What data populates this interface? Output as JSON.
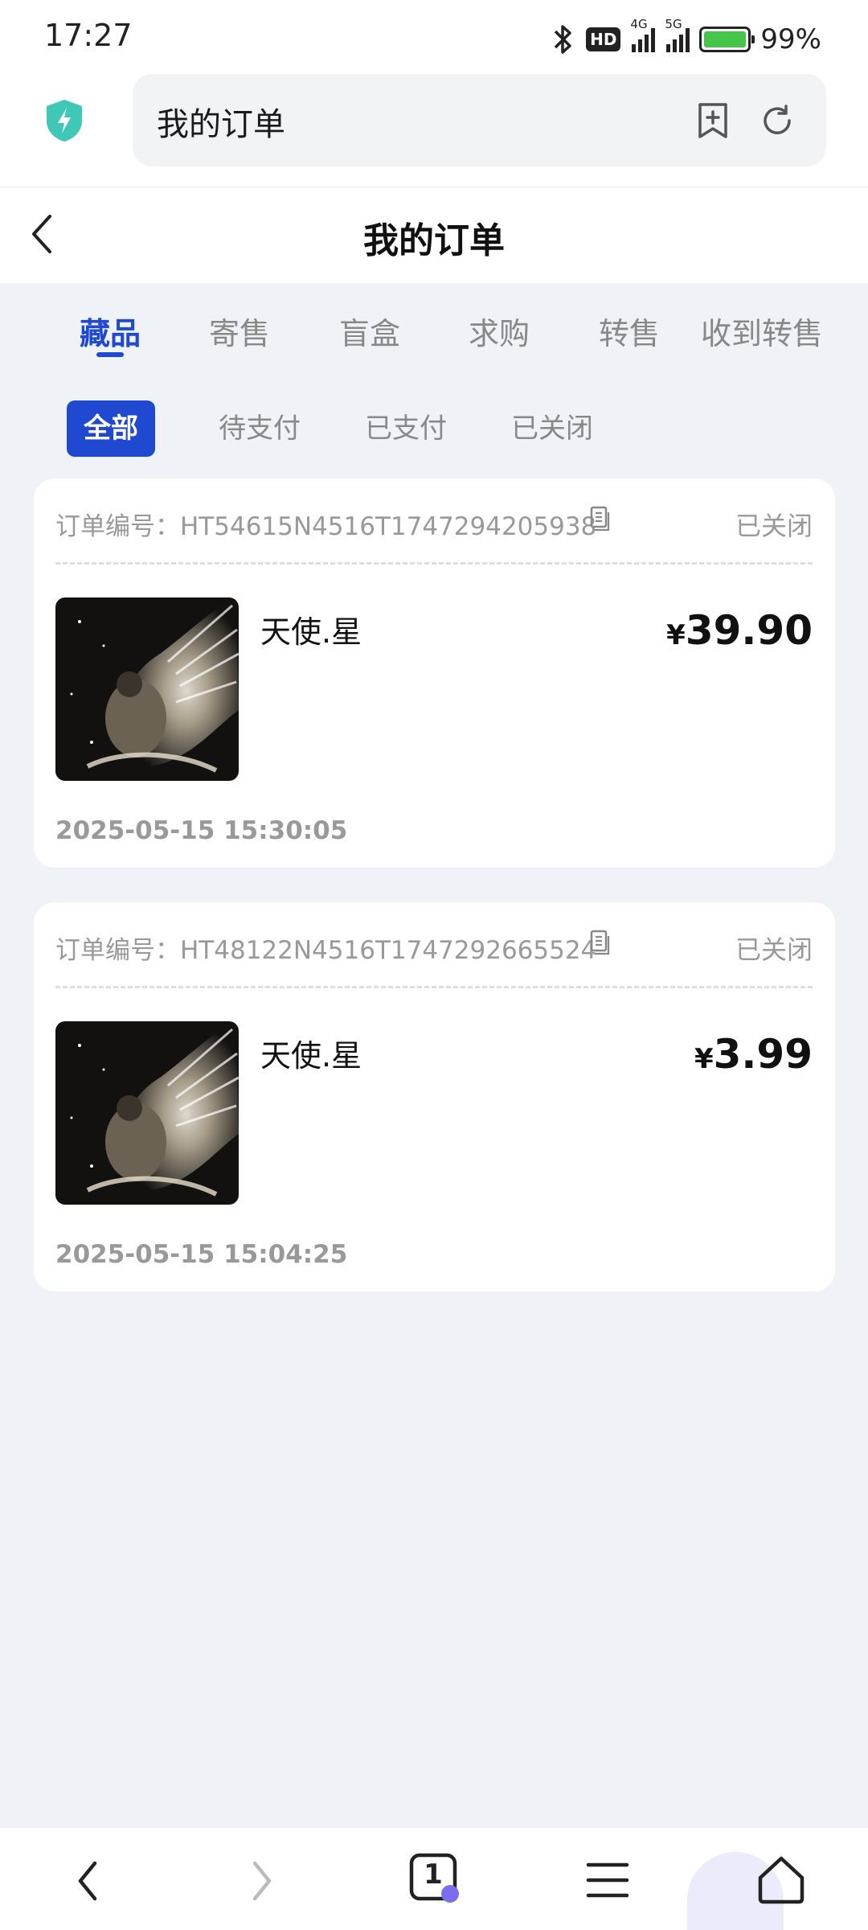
{
  "status_bar": {
    "time": "17:27",
    "hd_label": "HD",
    "net1": "4G",
    "net2": "5G",
    "battery_text": "99%",
    "battery_level": 0.99
  },
  "browser": {
    "address_text": "我的订单",
    "tab_count": "1"
  },
  "header": {
    "title": "我的订单"
  },
  "tabs": [
    {
      "label": "藏品",
      "active": true
    },
    {
      "label": "寄售",
      "active": false
    },
    {
      "label": "盲盒",
      "active": false
    },
    {
      "label": "求购",
      "active": false
    },
    {
      "label": "转售",
      "active": false
    },
    {
      "label": "收到转售",
      "active": false
    }
  ],
  "filters": [
    {
      "label": "全部",
      "active": true
    },
    {
      "label": "待支付",
      "active": false
    },
    {
      "label": "已支付",
      "active": false
    },
    {
      "label": "已关闭",
      "active": false
    }
  ],
  "orders": [
    {
      "order_no": "订单编号：HT54615N4516T1747294205938",
      "status": "已关闭",
      "item_name": "天使.星",
      "currency": "¥",
      "price": "39.90",
      "time": "2025-05-15 15:30:05"
    },
    {
      "order_no": "订单编号：HT48122N4516T1747292665524",
      "status": "已关闭",
      "item_name": "天使.星",
      "currency": "¥",
      "price": "3.99",
      "time": "2025-05-15 15:04:25"
    }
  ],
  "colors": {
    "accent": "#1f49d1",
    "background": "#eff3f8",
    "muted_text": "#999999"
  },
  "icons": [
    "bluetooth-icon",
    "shield-icon",
    "bookmark-add-icon",
    "refresh-icon",
    "back-icon",
    "copy-icon",
    "nav-back-icon",
    "nav-forward-icon",
    "tabs-icon",
    "menu-icon",
    "home-icon"
  ]
}
